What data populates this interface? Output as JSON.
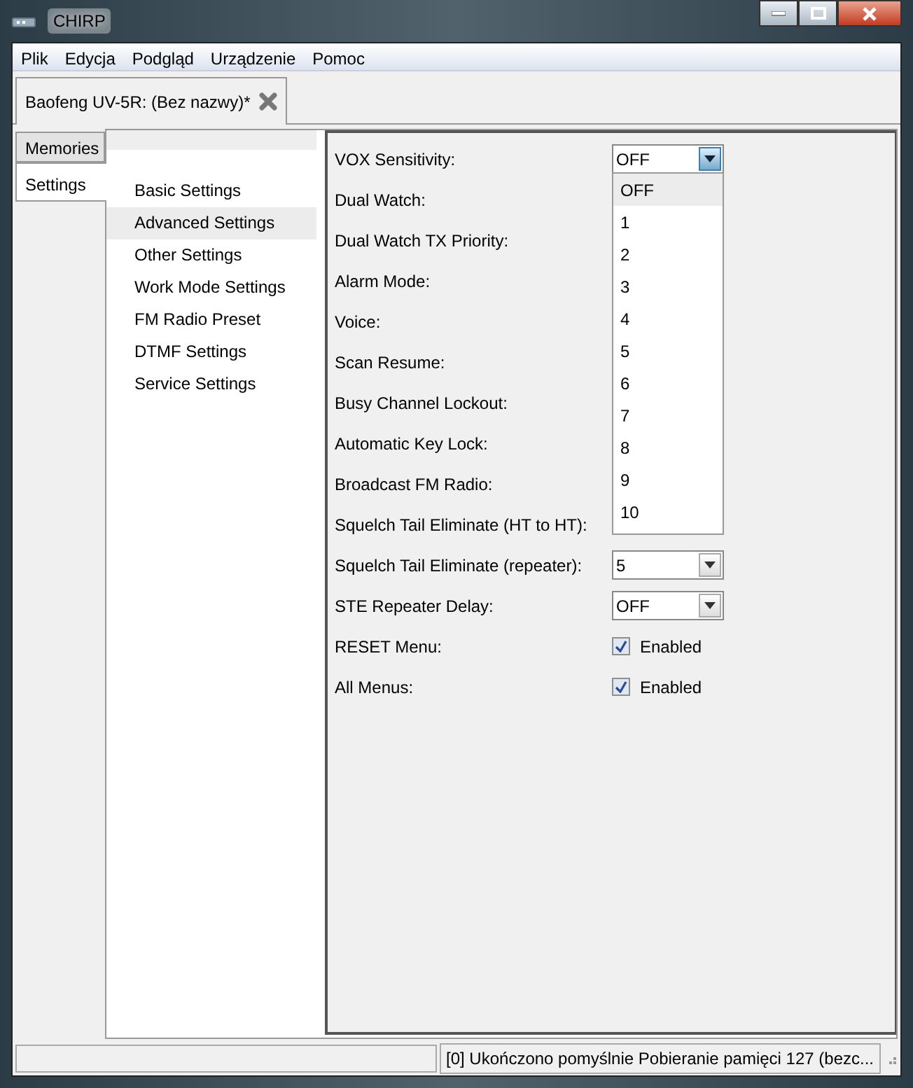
{
  "window": {
    "title": "CHIRP"
  },
  "menu": [
    "Plik",
    "Edycja",
    "Podgląd",
    "Urządzenie",
    "Pomoc"
  ],
  "doc_tabs": [
    {
      "label": "Baofeng UV-5R: (Bez nazwy)*",
      "selected": true
    }
  ],
  "side_tabs": [
    {
      "label": "Memories",
      "selected": false
    },
    {
      "label": "Settings",
      "selected": true
    }
  ],
  "sections": [
    {
      "label": "Basic Settings",
      "selected": false
    },
    {
      "label": "Advanced Settings",
      "selected": true
    },
    {
      "label": "Other Settings",
      "selected": false
    },
    {
      "label": "Work Mode Settings",
      "selected": false
    },
    {
      "label": "FM Radio Preset",
      "selected": false
    },
    {
      "label": "DTMF Settings",
      "selected": false
    },
    {
      "label": "Service Settings",
      "selected": false
    }
  ],
  "settings": [
    {
      "label": "VOX Sensitivity:",
      "kind": "combo",
      "value": "OFF",
      "expanded": true
    },
    {
      "label": "Dual Watch:",
      "kind": "covered"
    },
    {
      "label": "Dual Watch TX Priority:",
      "kind": "covered"
    },
    {
      "label": "Alarm Mode:",
      "kind": "covered"
    },
    {
      "label": "Voice:",
      "kind": "covered"
    },
    {
      "label": "Scan Resume:",
      "kind": "covered"
    },
    {
      "label": "Busy Channel Lockout:",
      "kind": "covered"
    },
    {
      "label": "Automatic Key Lock:",
      "kind": "covered"
    },
    {
      "label": "Broadcast FM Radio:",
      "kind": "covered"
    },
    {
      "label": "Squelch Tail Eliminate (HT to HT):",
      "kind": "covered"
    },
    {
      "label": "Squelch Tail Eliminate (repeater):",
      "kind": "combo",
      "value": "5",
      "expanded": false
    },
    {
      "label": "STE Repeater Delay:",
      "kind": "combo",
      "value": "OFF",
      "expanded": false
    },
    {
      "label": "RESET Menu:",
      "kind": "checkbox",
      "text": "Enabled",
      "checked": true
    },
    {
      "label": "All Menus:",
      "kind": "checkbox",
      "text": "Enabled",
      "checked": true
    }
  ],
  "dropdown_options": [
    {
      "label": "OFF",
      "selected": true
    },
    {
      "label": "1",
      "selected": false
    },
    {
      "label": "2",
      "selected": false
    },
    {
      "label": "3",
      "selected": false
    },
    {
      "label": "4",
      "selected": false
    },
    {
      "label": "5",
      "selected": false
    },
    {
      "label": "6",
      "selected": false
    },
    {
      "label": "7",
      "selected": false
    },
    {
      "label": "8",
      "selected": false
    },
    {
      "label": "9",
      "selected": false
    },
    {
      "label": "10",
      "selected": false
    }
  ],
  "status_bar": {
    "message": "[0] Ukończono pomyślnie Pobieranie pamięci 127 (bezc..."
  }
}
